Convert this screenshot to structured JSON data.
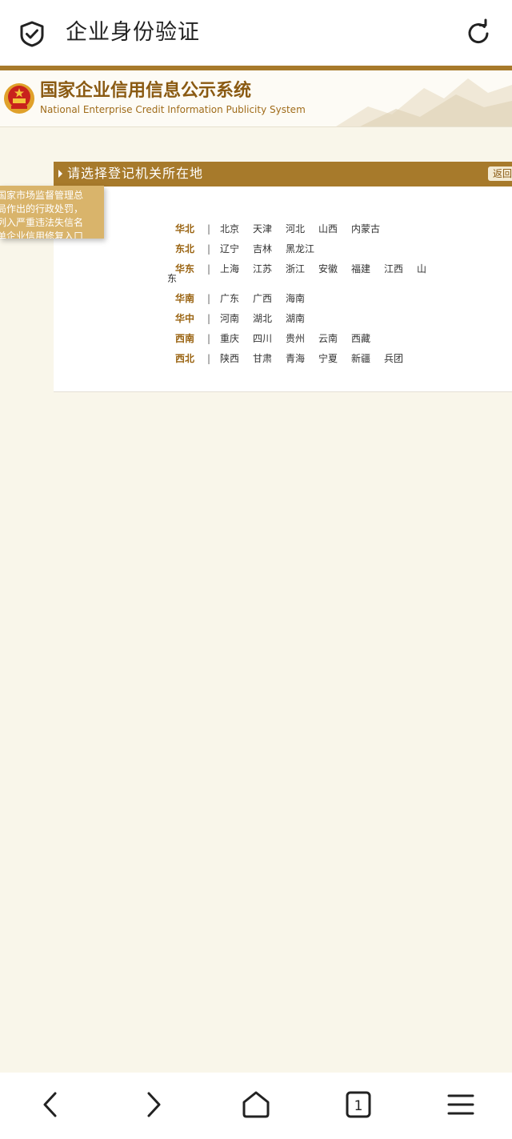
{
  "topbar": {
    "title": "企业身份验证",
    "left_icon": "shield-check-icon",
    "right_icon": "reload-icon"
  },
  "banner": {
    "title_cn": "国家企业信用信息公示系统",
    "title_en": "National Enterprise Credit Information Publicity System"
  },
  "panel": {
    "heading": "请选择登记机关所在地",
    "back_label": "返回",
    "regions": [
      {
        "name": "华北",
        "provinces": [
          "北京",
          "天津",
          "河北",
          "山西",
          "内蒙古"
        ]
      },
      {
        "name": "东北",
        "provinces": [
          "辽宁",
          "吉林",
          "黑龙江"
        ]
      },
      {
        "name": "华东",
        "provinces": [
          "上海",
          "江苏",
          "浙江",
          "安徽",
          "福建",
          "江西",
          "山"
        ]
      },
      {
        "name": "华南",
        "provinces": [
          "广东",
          "广西",
          "海南"
        ]
      },
      {
        "name": "华中",
        "provinces": [
          "河南",
          "湖北",
          "湖南"
        ]
      },
      {
        "name": "西南",
        "provinces": [
          "重庆",
          "四川",
          "贵州",
          "云南",
          "西藏"
        ]
      },
      {
        "name": "西北",
        "provinces": [
          "陕西",
          "甘肃",
          "青海",
          "宁夏",
          "新疆",
          "兵团"
        ]
      }
    ],
    "wrap_char": "东"
  },
  "notice": {
    "lines": [
      "国家市场监督管理总",
      "局作出的行政处罚，",
      "列入严重违法失信名",
      "单企业信用修复入口"
    ]
  },
  "bottombar": {
    "icons": [
      "back-icon",
      "forward-icon",
      "home-icon",
      "tabs-icon",
      "menu-icon"
    ],
    "tab_count": "1"
  },
  "colors": {
    "accent": "#a77a2b",
    "page_bg": "#f9f6ea",
    "region_text": "#9a6412"
  }
}
